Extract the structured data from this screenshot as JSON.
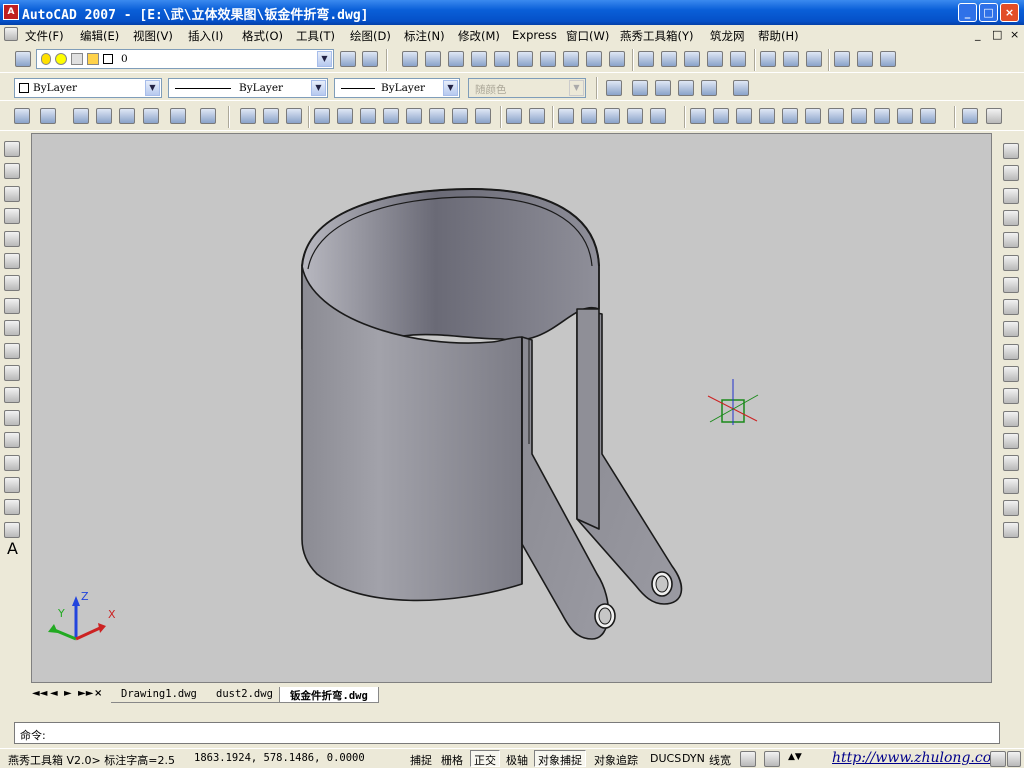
{
  "window": {
    "title": "AutoCAD 2007 - [E:\\武\\立体效果图\\钣金件折弯.dwg]",
    "min_label": "_",
    "max_label": "□",
    "close_label": "×"
  },
  "menu": {
    "items": [
      "文件(F)",
      "编辑(E)",
      "视图(V)",
      "插入(I)",
      "格式(O)",
      "工具(T)",
      "绘图(D)",
      "标注(N)",
      "修改(M)",
      "Express",
      "窗口(W)",
      "燕秀工具箱(Y)",
      "筑龙网",
      "帮助(H)"
    ],
    "doc_controls": [
      "_",
      "□",
      "×"
    ]
  },
  "layers": {
    "current_layer": "0"
  },
  "properties": {
    "color": "ByLayer",
    "linetype": "ByLayer",
    "lineweight": "ByLayer",
    "plotstyle": "随颜色"
  },
  "tabs": {
    "nav_glyphs": [
      "◄◄",
      "◄",
      "►",
      "►►",
      "×"
    ],
    "items": [
      {
        "label": "Drawing1.dwg",
        "active": false
      },
      {
        "label": "dust2.dwg",
        "active": false
      },
      {
        "label": "钣金件折弯.dwg",
        "active": true
      }
    ]
  },
  "command_line": {
    "prompt": "命令:"
  },
  "ucs": {
    "x": "X",
    "y": "Y",
    "z": "Z"
  },
  "status": {
    "plugin": "燕秀工具箱 V2.0> 标注字高=2.5",
    "coords": "1863.1924, 578.1486, 0.0000",
    "modes": [
      {
        "label": "捕捉",
        "on": false
      },
      {
        "label": "栅格",
        "on": false
      },
      {
        "label": "正交",
        "on": true
      },
      {
        "label": "极轴",
        "on": false
      },
      {
        "label": "对象捕捉",
        "on": true
      },
      {
        "label": "对象追踪",
        "on": false
      },
      {
        "label": "DUCS",
        "on": false
      },
      {
        "label": "DYN",
        "on": false
      },
      {
        "label": "线宽",
        "on": false
      }
    ],
    "url": "http://www.zhulong.com"
  }
}
